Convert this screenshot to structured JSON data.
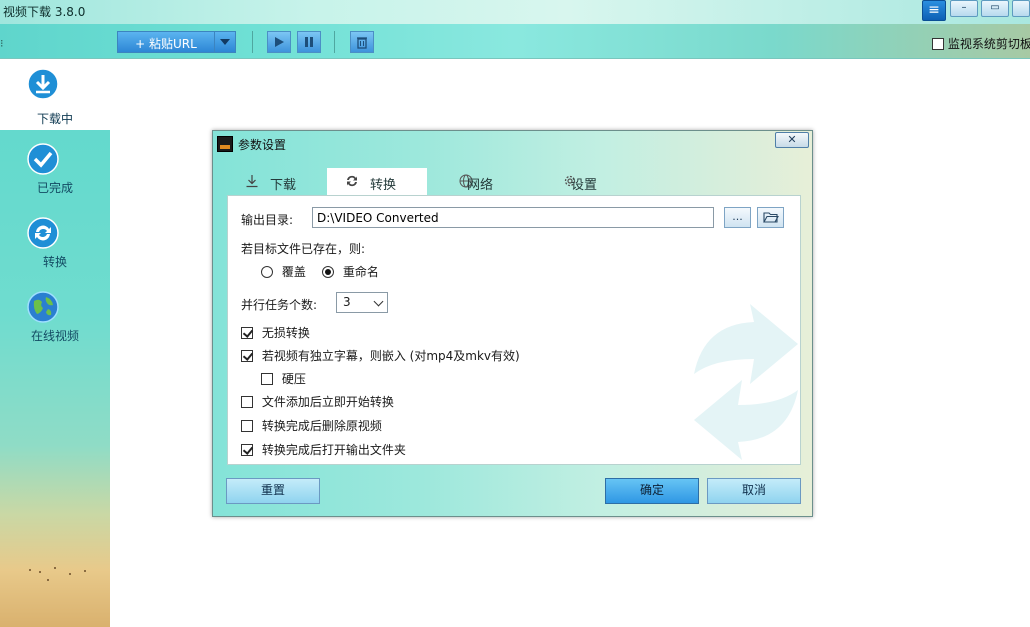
{
  "app": {
    "title": "视频下载 3.8.0"
  },
  "window_controls": {
    "menu_icon": "menu-icon",
    "minimize_icon": "minimize-icon",
    "maximize_icon": "maximize-icon",
    "close_icon": "close-icon"
  },
  "toolbar": {
    "paste_url_label": "+ 粘贴URL",
    "icons": [
      "play-icon",
      "pause-icon",
      "delete-icon"
    ],
    "monitor_clipboard_label": "监视系统剪切板",
    "monitor_clipboard_checked": false
  },
  "sidebar": {
    "items": [
      {
        "label": "下载中",
        "icon": "download-icon",
        "active": true
      },
      {
        "label": "已完成",
        "icon": "check-icon",
        "active": false
      },
      {
        "label": "转换",
        "icon": "convert-icon",
        "active": false
      },
      {
        "label": "在线视频",
        "icon": "globe-icon",
        "active": false
      }
    ]
  },
  "dialog": {
    "title": "参数设置",
    "close_icon": "close-icon",
    "tabs": [
      {
        "label": "下载",
        "icon": "download-icon",
        "active": false
      },
      {
        "label": "转换",
        "icon": "convert-icon",
        "active": true
      },
      {
        "label": "网络",
        "icon": "globe-icon",
        "active": false
      },
      {
        "label": "设置",
        "icon": "gear-icon",
        "active": false
      }
    ],
    "output_dir_label": "输出目录:",
    "output_dir_value": "D:\\VIDEO Converted",
    "browse_button_label": "...",
    "open_folder_icon": "folder-open-icon",
    "exists_label": "若目标文件已存在，则:",
    "overwrite_label": "覆盖",
    "overwrite_selected": false,
    "rename_label": "重命名",
    "rename_selected": true,
    "parallel_label": "并行任务个数:",
    "parallel_value": "3",
    "options": {
      "lossless": {
        "label": "无损转换",
        "checked": true
      },
      "embed_subtitle": {
        "label": "若视频有独立字幕，则嵌入 (对mp4及mkv有效)",
        "checked": true
      },
      "hard_sub": {
        "label": "硬压",
        "checked": false
      },
      "auto_start": {
        "label": "文件添加后立即开始转换",
        "checked": false
      },
      "delete_source": {
        "label": "转换完成后删除原视频",
        "checked": false
      },
      "open_folder": {
        "label": "转换完成后打开输出文件夹",
        "checked": true
      }
    },
    "reset_button": "重置",
    "ok_button": "确定",
    "cancel_button": "取消"
  },
  "colors": {
    "accent": "#2f97e4",
    "sidebar_teal": "#5fd8cc",
    "label_blue": "#0f3a52"
  }
}
